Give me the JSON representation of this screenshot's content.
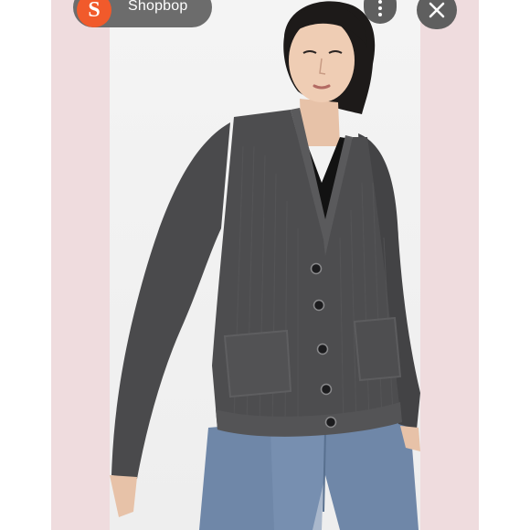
{
  "header": {
    "app_name": "Shopbop",
    "logo_letter": "S",
    "logo_color": "#f15a2b",
    "more_icon": "more-vertical-icon",
    "close_icon": "close-icon"
  },
  "image": {
    "subject": "product-photo-cardigan"
  },
  "colors": {
    "frame_background": "#efdcde",
    "photo_background": "#f2f2f2",
    "sweater": "#4b4b4d",
    "jeans": "#6f87a8"
  }
}
